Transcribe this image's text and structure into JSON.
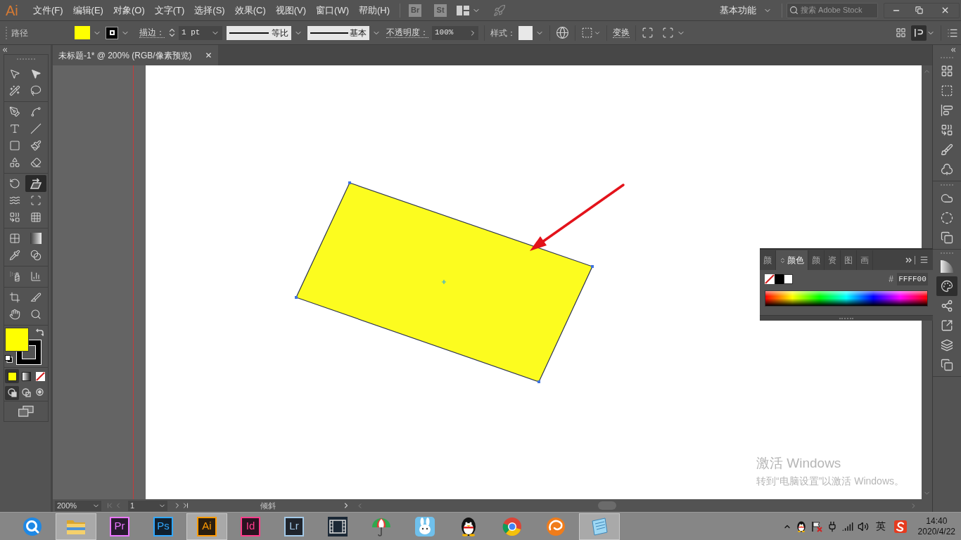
{
  "app": {
    "logo": "Ai"
  },
  "menu": [
    "文件(F)",
    "编辑(E)",
    "对象(O)",
    "文字(T)",
    "选择(S)",
    "效果(C)",
    "视图(V)",
    "窗口(W)",
    "帮助(H)"
  ],
  "bridge_tiles": [
    "Br",
    "St"
  ],
  "workspace": "基本功能",
  "search": {
    "placeholder": "搜索 Adobe Stock"
  },
  "control_bar": {
    "object_type": "路径",
    "stroke_label": "描边：",
    "stroke_weight": "1 pt",
    "profile": "等比",
    "brush": "基本",
    "opacity_label": "不透明度：",
    "opacity": "100%",
    "style_label": "样式：",
    "transform_label": "变换",
    "view_toggles": [
      {
        "selected": false
      },
      {
        "selected": true
      }
    ]
  },
  "tool_groups": [
    {
      "tools": [
        {
          "selected": false
        },
        {
          "selected": false
        },
        {
          "selected": false
        },
        {
          "selected": false
        }
      ]
    },
    {
      "tools": [
        {
          "selected": false
        },
        {
          "selected": false
        },
        {
          "selected": false
        },
        {
          "selected": false
        },
        {
          "selected": false
        },
        {
          "selected": false
        },
        {
          "selected": false
        },
        {
          "selected": false
        }
      ]
    },
    {
      "tools": [
        {
          "selected": false
        },
        {
          "selected": true
        },
        {
          "selected": false
        },
        {
          "selected": false
        },
        {
          "selected": false
        },
        {
          "selected": false
        }
      ]
    },
    {
      "tools": [
        {
          "selected": false
        },
        {
          "selected": false
        },
        {
          "selected": false
        },
        {
          "selected": false
        }
      ]
    },
    {
      "tools": [
        {
          "selected": false
        },
        {
          "selected": false
        }
      ]
    },
    {
      "tools": [
        {
          "selected": false
        },
        {
          "selected": false
        },
        {
          "selected": false
        },
        {
          "selected": false
        }
      ]
    }
  ],
  "color_modes": [
    {
      "selected": true
    },
    {
      "selected": false
    },
    {
      "selected": false
    }
  ],
  "draw_modes": [
    {
      "selected": true
    },
    {
      "selected": false
    },
    {
      "selected": false
    }
  ],
  "document": {
    "tab_title": "未标题-1* @ 200% (RGB/像素预览)"
  },
  "os_notice": {
    "title": "激活 Windows",
    "body": "转到“电脑设置”以激活 Windows。"
  },
  "status_bar": {
    "zoom": "200%",
    "artboard": "1",
    "tool": "倾斜"
  },
  "color_panel": {
    "tabs": [
      {
        "label": "颜",
        "selected": false
      },
      {
        "label": "颜色",
        "selected": true
      },
      {
        "label": "颜",
        "selected": false
      },
      {
        "label": "资",
        "selected": false
      },
      {
        "label": "图",
        "selected": false
      },
      {
        "label": "画",
        "selected": false
      }
    ],
    "hex_prefix": "#",
    "hex": "FFFF00"
  },
  "dock": [
    {
      "panels": [
        {
          "selected": false
        },
        {
          "selected": false
        },
        {
          "selected": false
        },
        {
          "selected": false
        },
        {
          "selected": false
        },
        {
          "selected": false
        }
      ]
    },
    {
      "panels": [
        {
          "selected": false
        },
        {
          "selected": false
        },
        {
          "selected": false
        }
      ]
    },
    {
      "panels": [
        {
          "selected": false
        },
        {
          "selected": true
        },
        {
          "selected": false
        },
        {
          "selected": false
        },
        {
          "selected": false
        },
        {
          "selected": false
        }
      ]
    }
  ],
  "taskbar": {
    "apps": [
      {
        "kind": "ring",
        "selected": false
      },
      {
        "kind": "folder",
        "selected": true
      },
      {
        "kind": "tile",
        "label": "Pr",
        "color": "#ea77ff",
        "selected": false
      },
      {
        "kind": "tile",
        "label": "Ps",
        "color": "#31a8ff",
        "selected": false
      },
      {
        "kind": "tile",
        "label": "Ai",
        "color": "#ff9a00",
        "selected": true
      },
      {
        "kind": "tile",
        "label": "Id",
        "color": "#ff3d8b",
        "selected": false
      },
      {
        "kind": "tile",
        "label": "Lr",
        "color": "#a3c9e8",
        "selected": false
      },
      {
        "kind": "film",
        "selected": false
      },
      {
        "kind": "umbrella",
        "selected": false
      },
      {
        "kind": "rabbit",
        "selected": false
      },
      {
        "kind": "penguin",
        "selected": false
      },
      {
        "kind": "wheel",
        "selected": false
      },
      {
        "kind": "swirl",
        "selected": false
      },
      {
        "kind": "notepad",
        "selected": true
      }
    ],
    "tray": {
      "ime": "英",
      "time": "14:40",
      "date": "2020/4/22"
    }
  }
}
